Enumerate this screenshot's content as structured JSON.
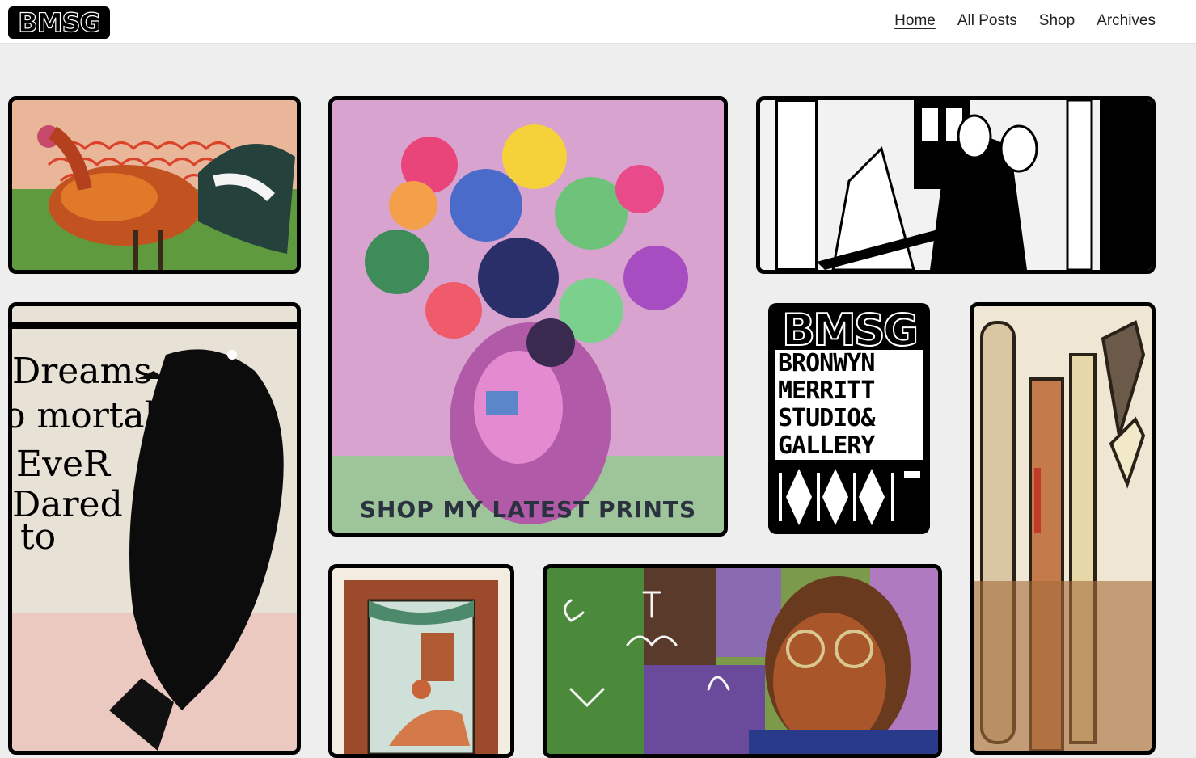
{
  "header": {
    "logo_text": "BMSG",
    "nav": [
      {
        "label": "Home",
        "active": true
      },
      {
        "label": "All Posts",
        "active": false
      },
      {
        "label": "Shop",
        "active": false
      },
      {
        "label": "Archives",
        "active": false
      }
    ]
  },
  "tiles": {
    "rooster": {
      "name": "rooster-painting"
    },
    "flowers": {
      "caption": "SHOP MY LATEST PRINTS"
    },
    "couple": {
      "name": "linocut-couple-print"
    },
    "raven": {
      "name": "raven-linocut-print"
    },
    "logo_card": {
      "big": "BMSG",
      "lines": [
        "BRONWYN",
        "MERRITT",
        "STUDIO&",
        "GALLERY"
      ]
    },
    "brushes": {
      "name": "paintbrushes-painting"
    },
    "window": {
      "name": "window-reader-print"
    },
    "portrait": {
      "name": "great-things-portrait"
    }
  },
  "colors": {
    "page_bg": "#eeeeee",
    "header_bg": "#ffffff",
    "frame": "#000000",
    "caption": "#2a3240"
  }
}
